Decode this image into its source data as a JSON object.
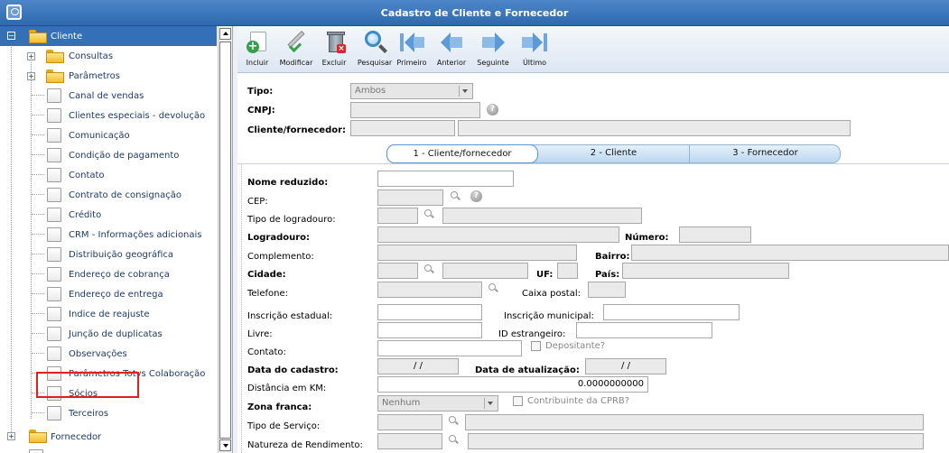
{
  "window": {
    "title": "Cadastro de Cliente e Fornecedor"
  },
  "tree": {
    "root": "Cliente",
    "items": [
      {
        "label": "Consultas",
        "type": "folder"
      },
      {
        "label": "Parâmetros",
        "type": "folder"
      },
      {
        "label": "Canal de vendas",
        "type": "doc"
      },
      {
        "label": "Clientes especiais - devolução",
        "type": "doc"
      },
      {
        "label": "Comunicação",
        "type": "doc"
      },
      {
        "label": "Condição de pagamento",
        "type": "doc"
      },
      {
        "label": "Contato",
        "type": "doc"
      },
      {
        "label": "Contrato de consignação",
        "type": "doc"
      },
      {
        "label": "Crédito",
        "type": "doc"
      },
      {
        "label": "CRM - Informações adicionais",
        "type": "doc"
      },
      {
        "label": "Distribuição geográfica",
        "type": "doc"
      },
      {
        "label": "Endereço de cobrança",
        "type": "doc"
      },
      {
        "label": "Endereço de entrega",
        "type": "doc"
      },
      {
        "label": "Indice de reajuste",
        "type": "doc"
      },
      {
        "label": "Junção de duplicatas",
        "type": "doc"
      },
      {
        "label": "Observações",
        "type": "doc"
      },
      {
        "label": "Parâmetros Totvs Colaboração",
        "type": "doc"
      },
      {
        "label": "Sócios",
        "type": "doc"
      },
      {
        "label": "Terceiros",
        "type": "doc"
      }
    ],
    "second_root": "Fornecedor"
  },
  "toolbar": {
    "incluir": "Incluir",
    "modificar": "Modificar",
    "excluir": "Excluir",
    "pesquisar": "Pesquisar",
    "primeiro": "Primeiro",
    "anterior": "Anterior",
    "seguinte": "Seguinte",
    "ultimo": "Último"
  },
  "header": {
    "tipo_label": "Tipo:",
    "tipo_value": "Ambos",
    "cnpj_label": "CNPJ:",
    "cliente_label": "Cliente/fornecedor:"
  },
  "tabs": [
    {
      "label": "1 - Cliente/fornecedor"
    },
    {
      "label": "2 - Cliente"
    },
    {
      "label": "3 - Fornecedor"
    }
  ],
  "form": {
    "nome_reduzido": "Nome reduzido:",
    "cep": "CEP:",
    "tipo_logradouro": "Tipo de logradouro:",
    "logradouro": "Logradouro:",
    "numero": "Número:",
    "complemento": "Complemento:",
    "bairro": "Bairro:",
    "cidade": "Cidade:",
    "uf": "UF:",
    "pais": "País:",
    "telefone": "Telefone:",
    "caixa_postal": "Caixa postal:",
    "inscricao_estadual": "Inscrição estadual:",
    "inscricao_municipal": "Inscrição municipal:",
    "livre": "Livre:",
    "id_estrangeiro": "ID estrangeiro:",
    "depositante": "Depositante?",
    "contato": "Contato:",
    "data_cadastro": "Data do cadastro:",
    "data_cadastro_value": "/ /",
    "data_atualizacao": "Data de atualização:",
    "data_atualizacao_value": "/ /",
    "distancia": "Distância em KM:",
    "distancia_value": "0.0000000000",
    "zona_franca": "Zona franca:",
    "zona_franca_value": "Nenhum",
    "contribuinte_cprb": "Contribuinte da CPRB?",
    "tipo_servico": "Tipo de Serviço:",
    "natureza_rendimento": "Natureza de Rendimento:"
  },
  "colors": {
    "title_bar": "#3b78bf",
    "selected_row": "#3370b7",
    "highlight_box": "#e02020"
  }
}
